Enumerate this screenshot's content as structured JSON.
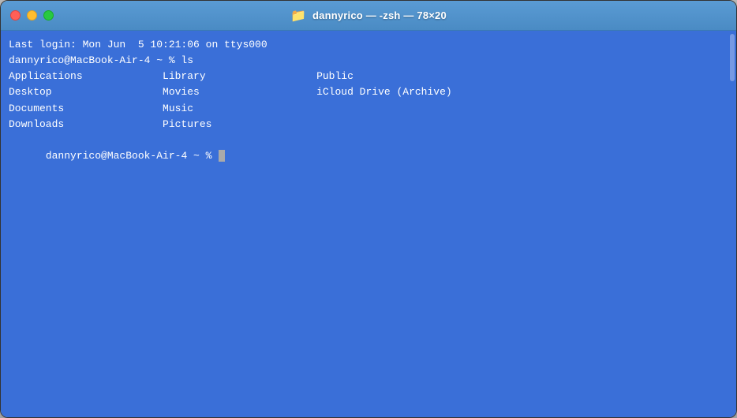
{
  "window": {
    "title": "dannyrico — -zsh — 78×20",
    "bg_color": "#3a6fd8"
  },
  "titlebar": {
    "traffic_lights": {
      "close": "close",
      "minimize": "minimize",
      "maximize": "maximize"
    },
    "folder_icon": "📁",
    "title": "dannyrico — -zsh — 78×20"
  },
  "terminal": {
    "lines": [
      "Last login: Mon Jun  5 10:21:06 on ttys000",
      "dannyrico@MacBook-Air-4 ~ % ls",
      "Applications             Library                  Public",
      "Desktop                  Movies                   iCloud Drive (Archive)",
      "Documents                Music",
      "Downloads                Pictures",
      "dannyrico@MacBook-Air-4 ~ % "
    ],
    "prompt": "dannyrico@MacBook-Air-4 ~ % "
  }
}
